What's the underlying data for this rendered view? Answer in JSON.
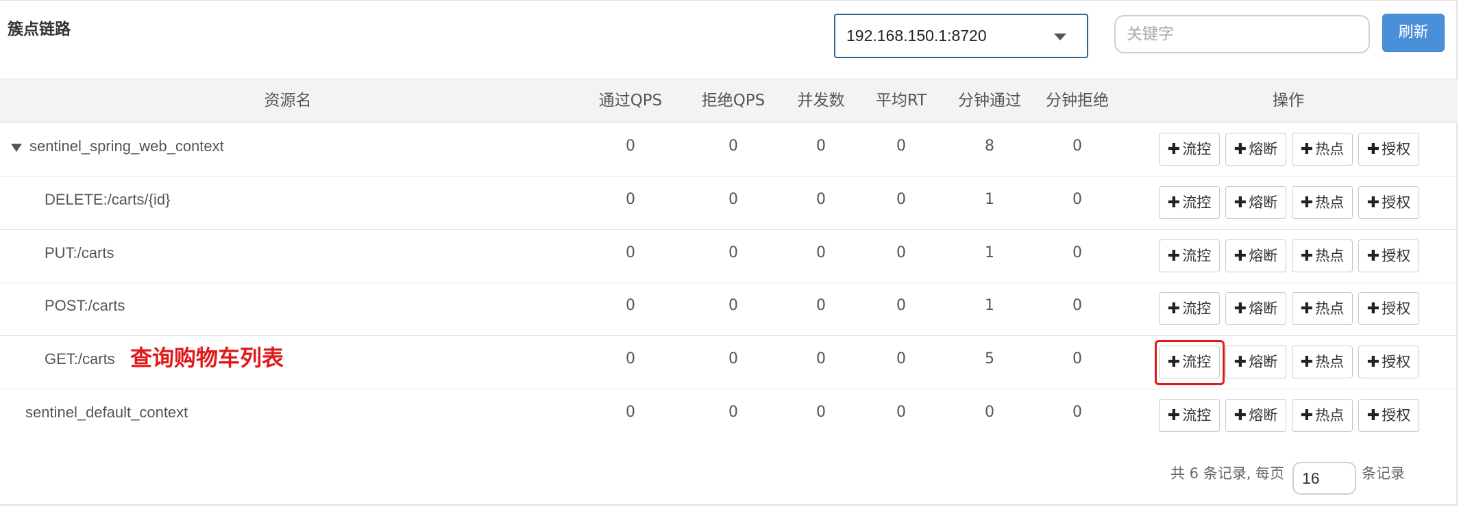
{
  "title": "簇点链路",
  "machine_select": {
    "value": "192.168.150.1:8720"
  },
  "search": {
    "placeholder": "关键字",
    "value": ""
  },
  "refresh_label": "刷新",
  "columns": {
    "resource": "资源名",
    "pass_qps": "通过QPS",
    "block_qps": "拒绝QPS",
    "concurrency": "并发数",
    "avg_rt": "平均RT",
    "minute_pass": "分钟通过",
    "minute_block": "分钟拒绝",
    "ops": "操作"
  },
  "op_labels": {
    "flow": "流控",
    "degrade": "熔断",
    "hotspot": "热点",
    "authority": "授权"
  },
  "rows": [
    {
      "name": "sentinel_spring_web_context",
      "expanded": true,
      "pass_qps": "0",
      "block_qps": "0",
      "concurrency": "0",
      "avg_rt": "0",
      "minute_pass": "8",
      "minute_block": "0"
    },
    {
      "name": "DELETE:/carts/{id}",
      "pass_qps": "0",
      "block_qps": "0",
      "concurrency": "0",
      "avg_rt": "0",
      "minute_pass": "1",
      "minute_block": "0"
    },
    {
      "name": "PUT:/carts",
      "pass_qps": "0",
      "block_qps": "0",
      "concurrency": "0",
      "avg_rt": "0",
      "minute_pass": "1",
      "minute_block": "0"
    },
    {
      "name": "POST:/carts",
      "pass_qps": "0",
      "block_qps": "0",
      "concurrency": "0",
      "avg_rt": "0",
      "minute_pass": "1",
      "minute_block": "0"
    },
    {
      "name": "GET:/carts",
      "annotation": "查询购物车列表",
      "pass_qps": "0",
      "block_qps": "0",
      "concurrency": "0",
      "avg_rt": "0",
      "minute_pass": "5",
      "minute_block": "0"
    },
    {
      "name": "sentinel_default_context",
      "pass_qps": "0",
      "block_qps": "0",
      "concurrency": "0",
      "avg_rt": "0",
      "minute_pass": "0",
      "minute_block": "0"
    }
  ],
  "pagination": {
    "summary": "共 6 条记录, 每页",
    "page_size": "16",
    "suffix": "条记录"
  },
  "colors": {
    "accent": "#4a90d9",
    "annotation": "#e01818",
    "header_bg": "#f3f3f3"
  }
}
